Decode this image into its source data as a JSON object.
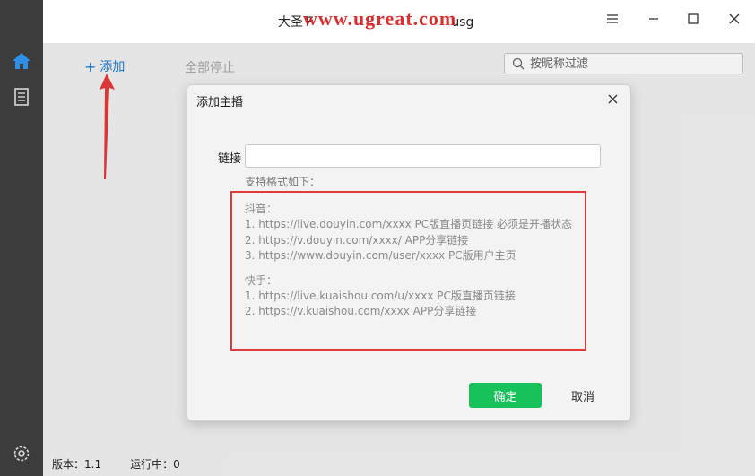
{
  "window": {
    "title": "大圣Ｆ",
    "title_tail": "usg",
    "watermark": "www.ugreat.com"
  },
  "toolbar": {
    "add_label": "添加",
    "stop_all_label": "全部停止",
    "search_placeholder": "按昵称过滤"
  },
  "status": {
    "version": "版本：1.1",
    "running": "运行中：0"
  },
  "dialog": {
    "title": "添加主播",
    "link_label": "链接",
    "link_value": "",
    "formats_title": "支持格式如下：",
    "douyin_title": "抖音：",
    "douyin_1": "1. https://live.douyin.com/xxxx PC版直播页链接 必须是开播状态",
    "douyin_2": "2. https://v.douyin.com/xxxx/ APP分享链接",
    "douyin_3": "3. https://www.douyin.com/user/xxxx PC版用户主页",
    "kuaishou_title": "快手：",
    "kuaishou_1": "1. https://live.kuaishou.com/u/xxxx PC版直播页链接",
    "kuaishou_2": "2. https://v.kuaishou.com/xxxx APP分享链接",
    "confirm_label": "确定",
    "cancel_label": "取消"
  },
  "icons": {
    "sidebar": [
      "home-icon",
      "document-icon",
      "settings-icon"
    ],
    "window": [
      "menu-icon",
      "minimize-icon",
      "maximize-icon",
      "close-icon"
    ]
  },
  "colors": {
    "sidebar_bg": "#3c3c3c",
    "accent_blue": "#1c7fd6",
    "confirm_green": "#17c25b",
    "highlight_red": "#e03a3a"
  }
}
